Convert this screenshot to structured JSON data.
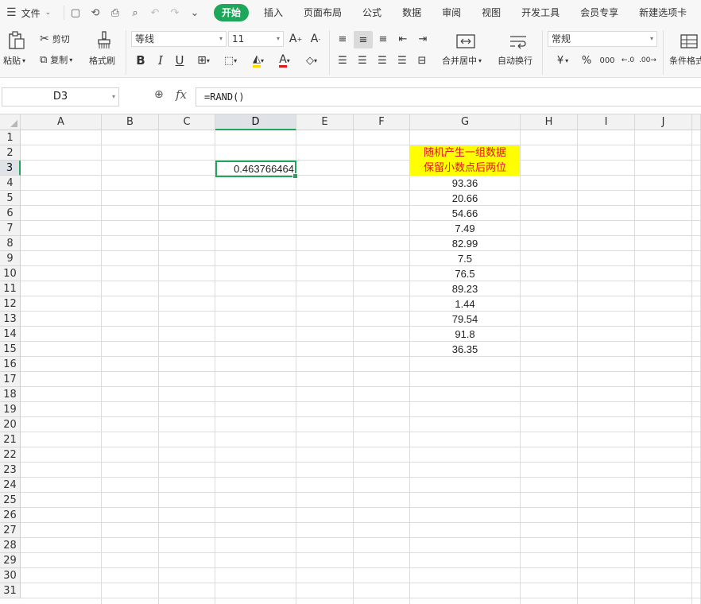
{
  "menu": {
    "file_label": "文件",
    "tabs": [
      "开始",
      "插入",
      "页面布局",
      "公式",
      "数据",
      "审阅",
      "视图",
      "开发工具",
      "会员专享",
      "新建选项卡"
    ],
    "active_tab": "开始"
  },
  "ribbon": {
    "paste": "粘贴",
    "cut": "剪切",
    "copy": "复制",
    "format_painter": "格式刷",
    "font_name": "等线",
    "font_size": "11",
    "merge_center": "合并居中",
    "wrap_text": "自动换行",
    "number_format": "常规",
    "conditional_format": "条件格式"
  },
  "formula_bar": {
    "name_box": "D3",
    "fx": "fx",
    "formula": "=RAND()"
  },
  "sheet": {
    "columns": [
      "A",
      "B",
      "C",
      "D",
      "E",
      "F",
      "G",
      "H",
      "I",
      "J"
    ],
    "selected_column": "D",
    "selected_row": 3,
    "row_count": 31,
    "active_cell_value": "0.463766464",
    "title_line1": "随机产生一组数据",
    "title_line2": "保留小数点后两位",
    "g_values": [
      "93.36",
      "20.66",
      "54.66",
      "7.49",
      "82.99",
      "7.5",
      "76.5",
      "89.23",
      "1.44",
      "79.54",
      "91.8",
      "36.35"
    ]
  },
  "colors": {
    "accent": "#1ea65a",
    "highlight_fill": "#ffff00",
    "highlight_text": "#e0161b"
  }
}
